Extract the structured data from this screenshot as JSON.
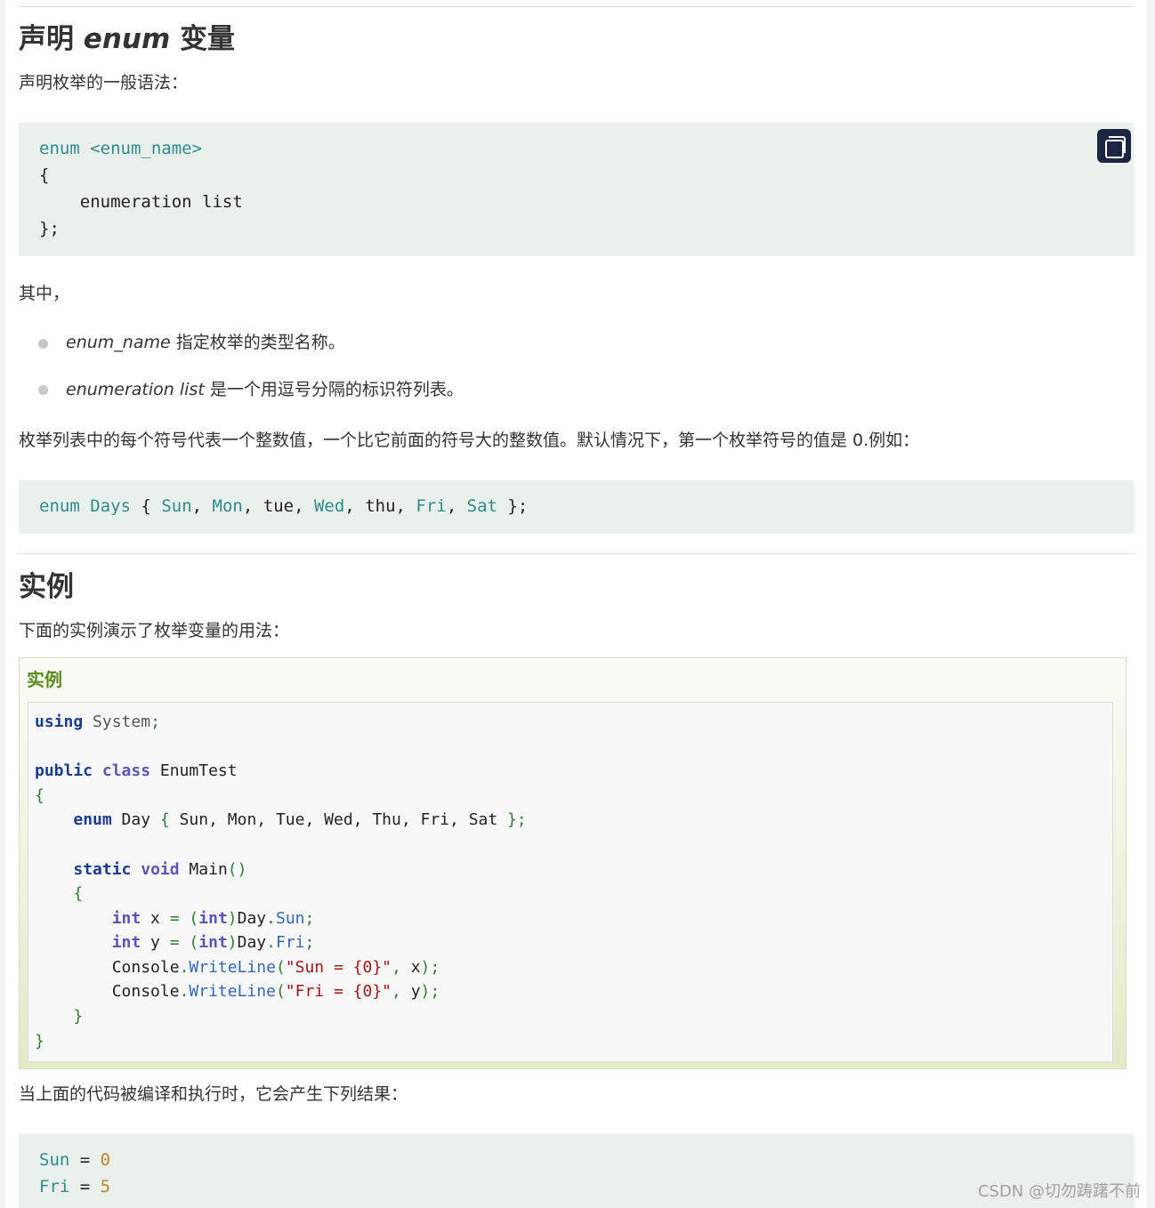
{
  "section1": {
    "heading_prefix": "声明",
    "heading_em": "enum",
    "heading_suffix": "变量",
    "intro": "声明枚举的一般语法：",
    "code": {
      "line1_kw": "enum",
      "line1_name": "<enum_name>",
      "line2": "{",
      "line3": "    enumeration list",
      "line4": "};"
    },
    "where": "其中，",
    "bullets": [
      {
        "em": "enum_name",
        "text": " 指定枚举的类型名称。"
      },
      {
        "em": "enumeration list",
        "text": " 是一个用逗号分隔的标识符列表。"
      }
    ],
    "desc": "枚举列表中的每个符号代表一个整数值，一个比它前面的符号大的整数值。默认情况下，第一个枚举符号的值是 0.例如：",
    "example_line": {
      "kw": "enum",
      "name": "Days",
      "open": " { ",
      "items": [
        "Sun",
        "Mon",
        "tue",
        "Wed",
        "thu",
        "Fri",
        "Sat"
      ],
      "close": " };"
    }
  },
  "section2": {
    "heading": "实例",
    "intro": "下面的实例演示了枚举变量的用法：",
    "example_title": "实例",
    "after": "当上面的代码被编译和执行时，它会产生下列结果：",
    "output": [
      {
        "name": "Sun",
        "eq": " = ",
        "val": "0"
      },
      {
        "name": "Fri",
        "eq": " = ",
        "val": "5"
      }
    ]
  },
  "watermark": "CSDN @切勿踌躇不前",
  "icons": {
    "copy": "copy-icon"
  }
}
